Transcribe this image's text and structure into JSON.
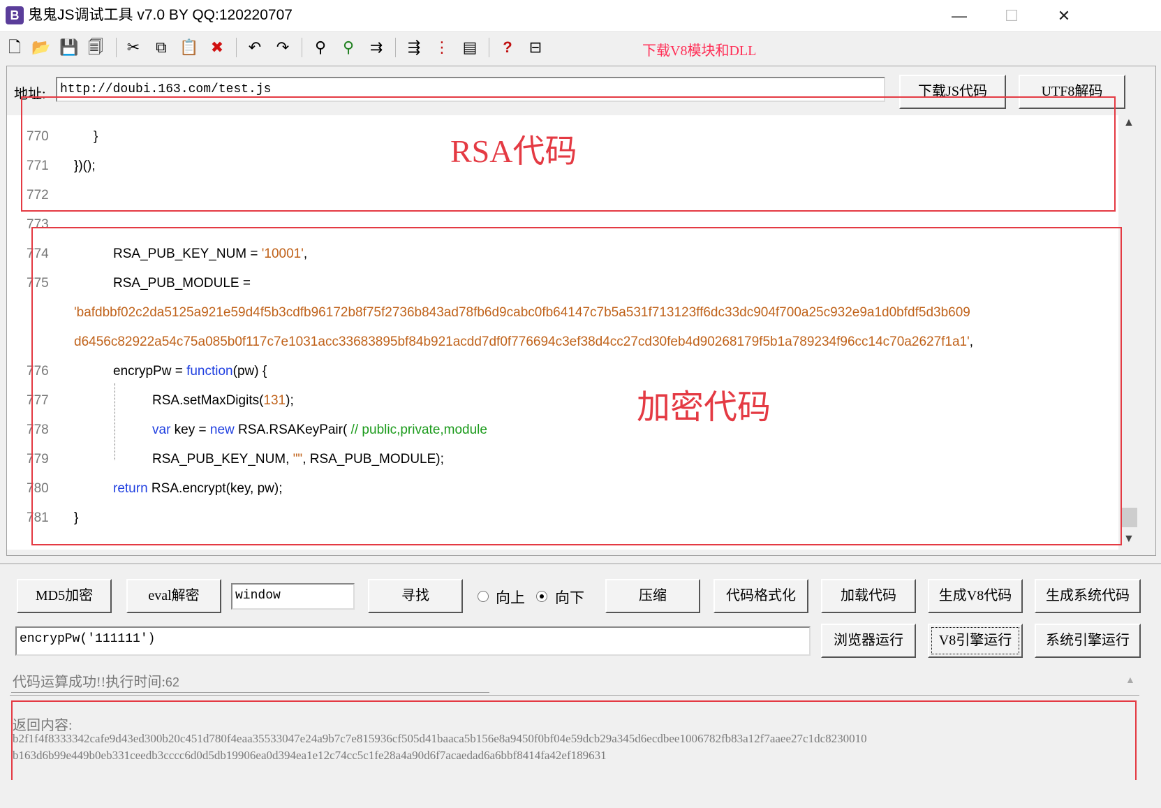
{
  "window": {
    "title": "鬼鬼JS调试工具 v7.0 BY QQ:120220707",
    "icon_letter": "B",
    "minimize": "—",
    "maximize": "☐",
    "close": "✕"
  },
  "toolbar": {
    "icons": [
      "new-file-icon",
      "open-folder-icon",
      "save-icon",
      "save-all-icon",
      "cut-icon",
      "copy-icon",
      "paste-icon",
      "delete-icon",
      "undo-icon",
      "redo-icon",
      "find-icon",
      "find-next-icon",
      "replace-icon",
      "indent-icon",
      "numbering-icon",
      "window-icon",
      "help-cursor-icon",
      "panel-icon"
    ],
    "glyphs": [
      "🗋",
      "📂",
      "💾",
      "🗐",
      "✂",
      "⧉",
      "📋",
      "✖",
      "↶",
      "↷",
      "⚲",
      "⚲",
      "⇉",
      "⇶",
      "⋮",
      "▤",
      "?",
      "⊟"
    ],
    "download_link": "下载V8模块和DLL",
    "link_color": "#ff2d55"
  },
  "address": {
    "label": "地址:",
    "value": "http://doubi.163.com/test.js",
    "download_button": "下载JS代码",
    "utf8_button": "UTF8解码"
  },
  "code": {
    "lines": [
      {
        "no": "770",
        "text": "}"
      },
      {
        "no": "771",
        "text": "})();"
      },
      {
        "no": "772",
        "text": ""
      },
      {
        "no": "773",
        "text": ""
      },
      {
        "no": "774",
        "pre": "RSA_PUB_KEY_NUM = ",
        "str": "'10001'",
        "post": ","
      },
      {
        "no": "775",
        "pre": "RSA_PUB_MODULE ="
      },
      {
        "str": "'bafdbbf02c2da5125a921e59d4f5b3cdfb96172b8f75f2736b843ad78fb6d9cabc0fb64147c7b5a531f713123ff6dc33dc904f700a25c932e9a1d0bfdf5d3b609"
      },
      {
        "str": "d6456c82922a54c75a085b0f117c7e1031acc33683895bf84b921acdd7df0f776694c3ef38d4cc27cd30feb4d90268179f5b1a789234f96cc14c70a2627f1a1'",
        "post": ","
      },
      {
        "no": "776",
        "pre": "encrypPw = ",
        "kw": "function",
        "post": "(pw) {"
      },
      {
        "no": "777",
        "pre": "RSA.setMaxDigits(",
        "num": "131",
        "post": ");"
      },
      {
        "no": "778",
        "kw": "var",
        "mid": " key = ",
        "kw2": "new",
        "post": " RSA.RSAKeyPair( ",
        "cmt": "// public,private,module"
      },
      {
        "no": "779",
        "pre": "RSA_PUB_KEY_NUM, ",
        "str": "\"\"",
        "post": ", RSA_PUB_MODULE);"
      },
      {
        "no": "780",
        "kw": "return",
        "post": " RSA.encrypt(key, pw);"
      },
      {
        "no": "781",
        "text": "}"
      }
    ]
  },
  "annotations": {
    "rsa_label": "RSA代码",
    "encrypt_label": "加密代码",
    "color": "#e43a43"
  },
  "controls": {
    "md5_button": "MD5加密",
    "eval_button": "eval解密",
    "eval_input": "window",
    "find_button": "寻找",
    "radio_up": "向上",
    "radio_down": "向下",
    "compress_button": "压缩",
    "format_button": "代码格式化",
    "load_button": "加载代码",
    "gen_v8_button": "生成V8代码",
    "gen_sys_button": "生成系统代码",
    "run_input": "encrypPw('111111')",
    "browser_run_button": "浏览器运行",
    "v8_run_button": "V8引擎运行",
    "sys_run_button": "系统引擎运行"
  },
  "output": {
    "status": "代码运算成功!!执行时间:",
    "time": "62",
    "return_label": "返回内容:",
    "line1": "b2f1f4f8333342cafe9d43ed300b20c451d780f4eaa35533047e24a9b7c7e815936cf505d41baaca5b156e8a9450f0bf04e59dcb29a345d6ecdbee1006782fb83a12f7aaee27c1dc8230010",
    "line2": "b163d6b99e449b0eb331ceedb3cccc6d0d5db19906ea0d394ea1e12c74cc5c1fe28a4a90d6f7acaedad6a6bbf8414fa42ef189631"
  }
}
